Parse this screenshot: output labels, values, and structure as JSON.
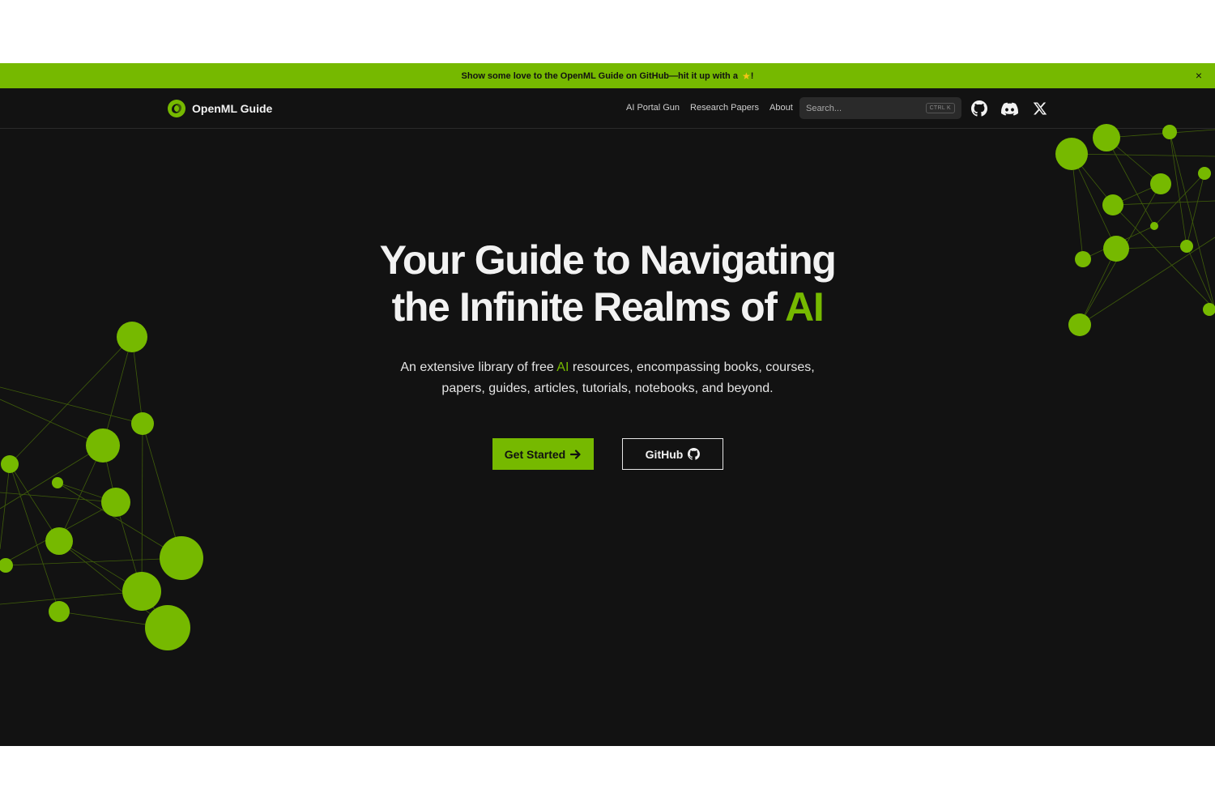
{
  "colors": {
    "accent": "#76b900",
    "background": "#121212",
    "text": "#f2f2f2"
  },
  "banner": {
    "message": "Show some love to the OpenML Guide on GitHub—hit it up with a",
    "star_icon": "star-icon",
    "suffix": "!",
    "close_label": "×"
  },
  "nav": {
    "brand": "OpenML Guide",
    "links": [
      "AI Portal Gun",
      "Research Papers",
      "About"
    ],
    "search": {
      "placeholder": "Search...",
      "shortcut": "CTRL K"
    },
    "icons": [
      "github-icon",
      "discord-icon",
      "x-icon"
    ]
  },
  "hero": {
    "title_line1": "Your Guide to Navigating",
    "title_line2_prefix": "the Infinite Realms of",
    "title_accent": "AI",
    "subtitle_prefix": "An extensive library of free",
    "subtitle_accent": "AI",
    "subtitle_line1_suffix": "resources, encompassing books, courses,",
    "subtitle_line2": "papers, guides, articles, tutorials, notebooks, and beyond."
  },
  "cta": {
    "primary_label": "Get Started",
    "primary_icon": "arrow-right-icon",
    "secondary_label": "GitHub",
    "secondary_icon": "github-icon"
  }
}
